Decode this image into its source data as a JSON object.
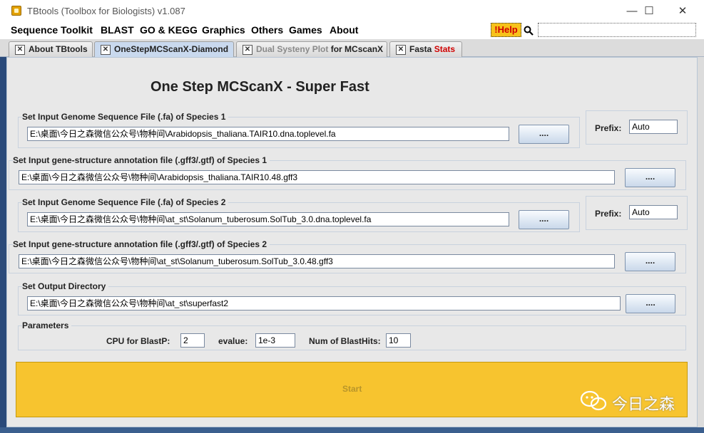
{
  "window": {
    "title": "TBtools (Toolbox for Biologists) v1.087",
    "minimize_glyph": "—",
    "maximize_glyph": "☐",
    "close_glyph": "✕"
  },
  "menu": {
    "items": [
      "Sequence Toolkit",
      "BLAST",
      "GO & KEGG",
      "Graphics",
      "Others",
      "Games",
      "About"
    ],
    "help_label": "!Help"
  },
  "tabs": [
    {
      "label": "About TBtools"
    },
    {
      "label": "OneStepMCScanX-Diamond"
    },
    {
      "label_a": "Dual Systeny Plot",
      "label_b": " for MCscanX"
    },
    {
      "label_a": "Fasta ",
      "label_b": "Stats"
    }
  ],
  "heading": "One Step MCScanX - Super Fast",
  "sections": {
    "genome1": {
      "label": "Set Input Genome Sequence File (.fa) of Species 1",
      "value": "E:\\桌面\\今日之森微信公众号\\物种间\\Arabidopsis_thaliana.TAIR10.dna.toplevel.fa",
      "button": "....",
      "prefix_label": "Prefix:",
      "prefix_value": "Auto"
    },
    "gff1": {
      "label": "Set Input gene-structure annotation file (.gff3/.gtf) of Species 1",
      "value": "E:\\桌面\\今日之森微信公众号\\物种间\\Arabidopsis_thaliana.TAIR10.48.gff3",
      "button": "...."
    },
    "genome2": {
      "label": "Set Input Genome Sequence File (.fa) of Species 2",
      "value": "E:\\桌面\\今日之森微信公众号\\物种间\\at_st\\Solanum_tuberosum.SolTub_3.0.dna.toplevel.fa",
      "button": "....",
      "prefix_label": "Prefix:",
      "prefix_value": "Auto"
    },
    "gff2": {
      "label": "Set Input gene-structure annotation file (.gff3/.gtf) of Species 2",
      "value": "E:\\桌面\\今日之森微信公众号\\物种间\\at_st\\Solanum_tuberosum.SolTub_3.0.48.gff3",
      "button": "...."
    },
    "output": {
      "label": "Set Output Directory",
      "value": "E:\\桌面\\今日之森微信公众号\\物种间\\at_st\\superfast2",
      "button": "...."
    }
  },
  "parameters": {
    "label": "Parameters",
    "cpu_label": "CPU for BlastP:",
    "cpu_value": "2",
    "evalue_label": "evalue:",
    "evalue_value": "1e-3",
    "hits_label": "Num of BlastHits:",
    "hits_value": "10"
  },
  "start_label": "Start",
  "watermark": "今日之森",
  "colors": {
    "help_bg": "#f7c21a",
    "start_bg": "#f7c42f",
    "tab_active": "#c9d9ee",
    "red_text": "#d00000"
  }
}
